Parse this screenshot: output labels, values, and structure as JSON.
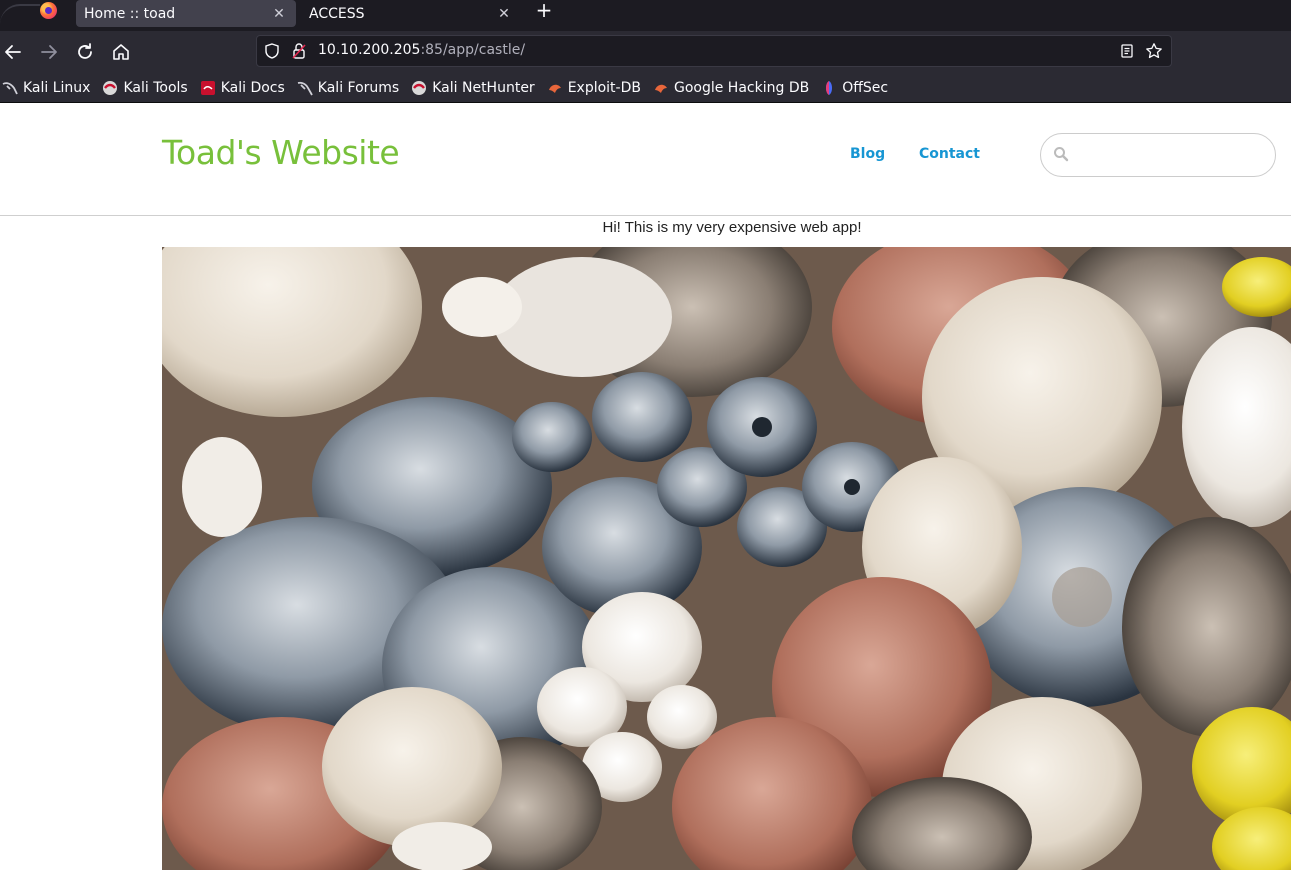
{
  "browser": {
    "tabs": [
      {
        "title": "Home :: toad",
        "active": true
      },
      {
        "title": "ACCESS",
        "active": false
      }
    ],
    "new_tab_label": "+",
    "close_glyph": "✕",
    "url_host": "10.10.200.205",
    "url_path": ":85/app/castle/",
    "bookmarks": [
      {
        "label": "Kali Linux",
        "icon": "kali-dragon-icon"
      },
      {
        "label": "Kali Tools",
        "icon": "kali-tools-icon"
      },
      {
        "label": "Kali Docs",
        "icon": "kali-docs-icon"
      },
      {
        "label": "Kali Forums",
        "icon": "kali-forums-icon"
      },
      {
        "label": "Kali NetHunter",
        "icon": "kali-nethunter-icon"
      },
      {
        "label": "Exploit-DB",
        "icon": "exploit-db-icon"
      },
      {
        "label": "Google Hacking DB",
        "icon": "ghdb-icon"
      },
      {
        "label": "OffSec",
        "icon": "offsec-icon"
      }
    ]
  },
  "site": {
    "title": "Toad's Website",
    "nav": {
      "blog": "Blog",
      "contact": "Contact"
    },
    "search": {
      "placeholder": "",
      "value": ""
    },
    "greeting": "Hi! This is my very expensive web app!",
    "hero_alt": "",
    "colors": {
      "title": "#78c03b",
      "nav_link": "#1796d3"
    }
  }
}
